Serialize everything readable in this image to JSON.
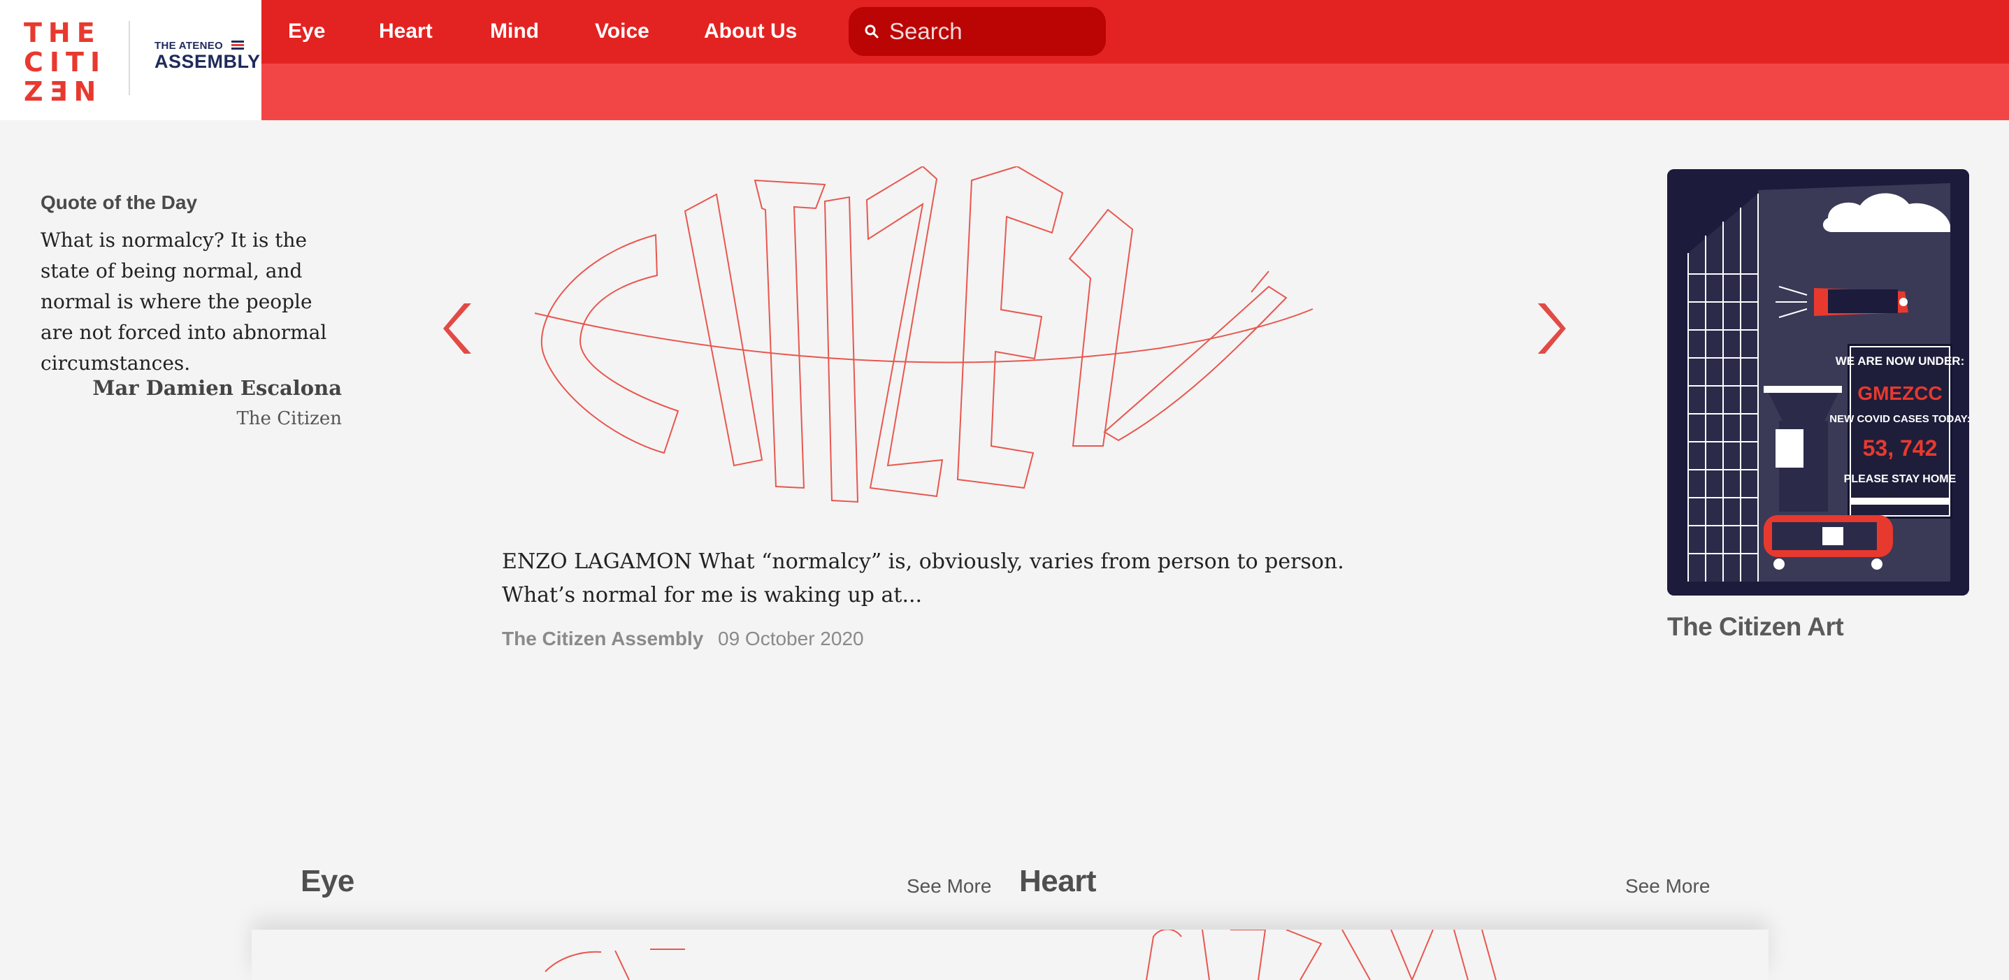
{
  "brand": {
    "logo_lines": [
      "THE",
      "CITI",
      "ZƎN"
    ],
    "partner_top": "THE ATENEO",
    "partner_bottom": "ASSEMBLY"
  },
  "nav": {
    "items": [
      "Eye",
      "Heart",
      "Mind",
      "Voice",
      "About Us"
    ],
    "search_placeholder": "Search"
  },
  "quote": {
    "heading": "Quote of the Day",
    "text": "What is normalcy? It is the state of being normal, and normal is where the people are not forced into abnormal circumstances.",
    "author": "Mar Damien Escalona",
    "source": "The Citizen"
  },
  "featured": {
    "excerpt": "ENZO LAGAMON What “normalcy” is, obviously, varies from person to person. What’s normal for me is waking up at...",
    "source": "The Citizen Assembly",
    "date": "09 October 2020"
  },
  "art": {
    "title": "The Citizen Art",
    "billboard_top": "WE ARE NOW UNDER:",
    "billboard_code": "GMEZCC",
    "billboard_mid": "NEW COVID CASES TODAY:",
    "billboard_number": "53, 742",
    "billboard_bottom": "PLEASE STAY HOME"
  },
  "sections": [
    {
      "title": "Eye",
      "see_more": "See More"
    },
    {
      "title": "Heart",
      "see_more": "See More"
    }
  ],
  "colors": {
    "nav_red": "#e32322",
    "subbar_red": "#f24646",
    "search_red": "#bb0404",
    "accent": "#e8392f",
    "art_bg": "#1c1b3c"
  }
}
